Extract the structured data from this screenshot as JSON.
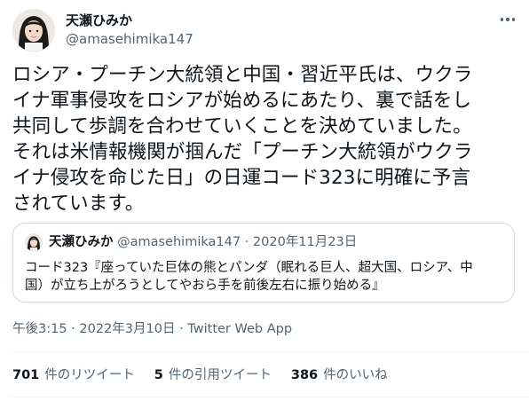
{
  "author": {
    "name": "天瀬ひみか",
    "handle": "@amasehimika147"
  },
  "tweet": {
    "text": "ロシア・プーチン大統領と中国・習近平氏は、ウクラ\nイナ軍事侵攻をロシアが始めるにあたり、裏で話をし\n共同して歩調を合わせていくことを決めていました。\nそれは米情報機関が掴んだ「プーチン大統領がウクラ\nイナ侵攻を命じた日」の日運コード323に明確に予言\nされています。"
  },
  "quote": {
    "name": "天瀬ひみか",
    "handle": "@amasehimika147",
    "separator": "·",
    "date": "2020年11月23日",
    "text": "コード323『座っていた巨体の熊とパンダ（眠れる巨人、超大国、ロシア、中\n国）が立ち上がろうとしてやおら手を前後左右に振り始める』"
  },
  "timestamp": {
    "time": "午後3:15",
    "separator": " · ",
    "date": "2022年3月10日",
    "source": "Twitter Web App"
  },
  "stats": {
    "retweets_count": "701",
    "retweets_label": "件のリツイート",
    "quotes_count": "5",
    "quotes_label": "件の引用ツイート",
    "likes_count": "386",
    "likes_label": "件のいいね"
  },
  "colors": {
    "text": "#0f1419",
    "secondary": "#536471",
    "border": "#cfd9de",
    "divider": "#eff3f4"
  },
  "icons": {
    "avatar": "avatar",
    "more": "more-icon"
  }
}
